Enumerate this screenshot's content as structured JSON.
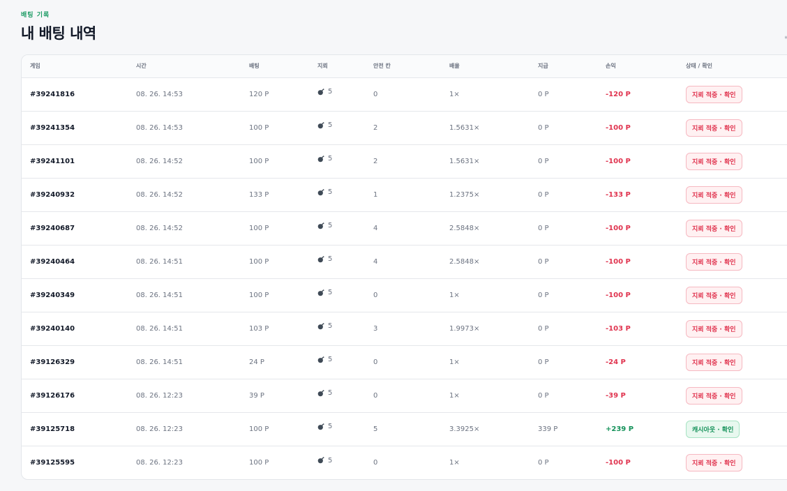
{
  "header": {
    "eyebrow": "배팅 기록",
    "title": "내 배팅 내역"
  },
  "columns": [
    "게임",
    "시간",
    "배팅",
    "지뢰",
    "안전 칸",
    "배율",
    "지급",
    "손익",
    "상태 / 확인"
  ],
  "rows": [
    {
      "game": "#39241816",
      "time": "08. 26. 14:53",
      "bet": "120 P",
      "mines": "5",
      "safe": "0",
      "multiplier": "1×",
      "payout": "0 P",
      "pl": "-120 P",
      "status": "지뢰 적중 · 확인",
      "result": "loss"
    },
    {
      "game": "#39241354",
      "time": "08. 26. 14:53",
      "bet": "100 P",
      "mines": "5",
      "safe": "2",
      "multiplier": "1.5631×",
      "payout": "0 P",
      "pl": "-100 P",
      "status": "지뢰 적중 · 확인",
      "result": "loss"
    },
    {
      "game": "#39241101",
      "time": "08. 26. 14:52",
      "bet": "100 P",
      "mines": "5",
      "safe": "2",
      "multiplier": "1.5631×",
      "payout": "0 P",
      "pl": "-100 P",
      "status": "지뢰 적중 · 확인",
      "result": "loss"
    },
    {
      "game": "#39240932",
      "time": "08. 26. 14:52",
      "bet": "133 P",
      "mines": "5",
      "safe": "1",
      "multiplier": "1.2375×",
      "payout": "0 P",
      "pl": "-133 P",
      "status": "지뢰 적중 · 확인",
      "result": "loss"
    },
    {
      "game": "#39240687",
      "time": "08. 26. 14:52",
      "bet": "100 P",
      "mines": "5",
      "safe": "4",
      "multiplier": "2.5848×",
      "payout": "0 P",
      "pl": "-100 P",
      "status": "지뢰 적중 · 확인",
      "result": "loss"
    },
    {
      "game": "#39240464",
      "time": "08. 26. 14:51",
      "bet": "100 P",
      "mines": "5",
      "safe": "4",
      "multiplier": "2.5848×",
      "payout": "0 P",
      "pl": "-100 P",
      "status": "지뢰 적중 · 확인",
      "result": "loss"
    },
    {
      "game": "#39240349",
      "time": "08. 26. 14:51",
      "bet": "100 P",
      "mines": "5",
      "safe": "0",
      "multiplier": "1×",
      "payout": "0 P",
      "pl": "-100 P",
      "status": "지뢰 적중 · 확인",
      "result": "loss"
    },
    {
      "game": "#39240140",
      "time": "08. 26. 14:51",
      "bet": "103 P",
      "mines": "5",
      "safe": "3",
      "multiplier": "1.9973×",
      "payout": "0 P",
      "pl": "-103 P",
      "status": "지뢰 적중 · 확인",
      "result": "loss"
    },
    {
      "game": "#39126329",
      "time": "08. 26. 14:51",
      "bet": "24 P",
      "mines": "5",
      "safe": "0",
      "multiplier": "1×",
      "payout": "0 P",
      "pl": "-24 P",
      "status": "지뢰 적중 · 확인",
      "result": "loss"
    },
    {
      "game": "#39126176",
      "time": "08. 26. 12:23",
      "bet": "39 P",
      "mines": "5",
      "safe": "0",
      "multiplier": "1×",
      "payout": "0 P",
      "pl": "-39 P",
      "status": "지뢰 적중 · 확인",
      "result": "loss"
    },
    {
      "game": "#39125718",
      "time": "08. 26. 12:23",
      "bet": "100 P",
      "mines": "5",
      "safe": "5",
      "multiplier": "3.3925×",
      "payout": "339 P",
      "pl": "+239 P",
      "status": "캐시아웃 · 확인",
      "result": "win"
    },
    {
      "game": "#39125595",
      "time": "08. 26. 12:23",
      "bet": "100 P",
      "mines": "5",
      "safe": "0",
      "multiplier": "1×",
      "payout": "0 P",
      "pl": "-100 P",
      "status": "지뢰 적중 · 확인",
      "result": "loss"
    }
  ],
  "icons": {
    "mines": "bomb-icon"
  },
  "colors": {
    "accent": "#1a9a63",
    "loss": "#e0344f",
    "win": "#15925a"
  }
}
